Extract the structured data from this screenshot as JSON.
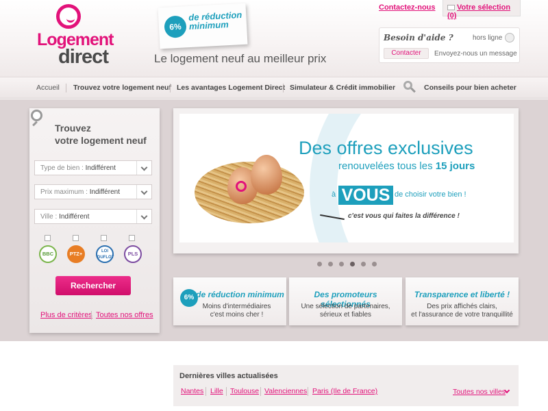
{
  "header": {
    "logo_line1": "Logement",
    "logo_line2": "direct",
    "promo_percent": "6%",
    "promo_text": "de réduction minimum",
    "tagline": "Le logement neuf au meilleur prix",
    "contact_link": "Contactez-nous",
    "selection_label": "Votre sélection (0)",
    "help": {
      "title": "Besoin d'aide ?",
      "status": "hors ligne",
      "contact_button": "Contacter",
      "send_message": "Envoyez-nous un message"
    }
  },
  "nav": {
    "items": [
      "Accueil",
      "Trouvez votre logement neuf",
      "Les avantages Logement Direct",
      "Simulateur & Crédit immobilier",
      "Conseils pour bien acheter"
    ]
  },
  "search": {
    "title_line1": "Trouvez",
    "title_line2": "votre logement neuf",
    "type_label": "Type de bien :",
    "type_value": "Indifférent",
    "price_label": "Prix maximum :",
    "price_value": "Indifférent",
    "city_label": "Ville :",
    "city_value": "Indifférent",
    "badges": [
      "BBC",
      "PTZ+",
      "LOI DUFLOT",
      "PLS"
    ],
    "button": "Rechercher",
    "more_criteria": "Plus de critères",
    "all_offers": "Toutes nos offres"
  },
  "banner": {
    "headline": "Des offres exclusives",
    "subline_pre": "renouvelées tous les ",
    "subline_bold": "15 jours",
    "vous_prefix": "à",
    "vous": "VOUS",
    "vous_suffix": "de choisir votre bien !",
    "handwritten": "c'est vous qui faites la différence !",
    "slides": 6,
    "active_slide": 4
  },
  "features": [
    {
      "badge": "6%",
      "title": "de réduction minimum",
      "text1": "Moins d'intermédiaires",
      "text2": "c'est moins cher !"
    },
    {
      "title": "Des promoteurs sélectionnés",
      "text1": "Une sélection de partenaires,",
      "text2": "sérieux et fiables"
    },
    {
      "title": "Transparence et liberté !",
      "text1": "Des prix affichés clairs,",
      "text2": "et l'assurance de votre tranquillité"
    }
  ],
  "cities": {
    "title": "Dernières villes actualisées",
    "items": [
      "Nantes",
      "Lille",
      "Toulouse",
      "Valenciennes",
      "Paris (Ile de France)"
    ],
    "all_cities": "Toutes nos villes"
  },
  "colors": {
    "brand_pink": "#e2127a",
    "accent_blue": "#1d9fbc",
    "background": "#dcd3d4"
  }
}
